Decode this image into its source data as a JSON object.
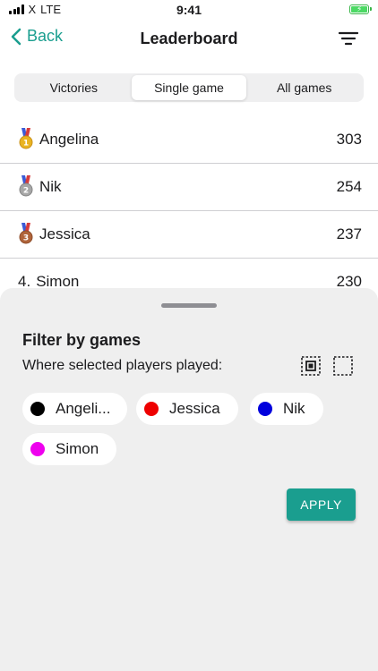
{
  "status_bar": {
    "carrier": "X",
    "network": "LTE",
    "time": "9:41"
  },
  "nav": {
    "back_label": "Back",
    "title": "Leaderboard"
  },
  "tabs": [
    {
      "label": "Victories",
      "active": false
    },
    {
      "label": "Single game",
      "active": true
    },
    {
      "label": "All games",
      "active": false
    }
  ],
  "leaderboard": [
    {
      "rank_prefix": "",
      "name": "Angelina",
      "score": "303",
      "medal": "gold"
    },
    {
      "rank_prefix": "",
      "name": "Nik",
      "score": "254",
      "medal": "silver"
    },
    {
      "rank_prefix": "",
      "name": "Jessica",
      "score": "237",
      "medal": "bronze"
    },
    {
      "rank_prefix": "4.",
      "name": "Simon",
      "score": "230",
      "medal": ""
    }
  ],
  "filter_sheet": {
    "title": "Filter by games",
    "subtitle": "Where selected players played:",
    "players": [
      {
        "name": "Angeli...",
        "color": "#000000"
      },
      {
        "name": "Jessica",
        "color": "#ee0000"
      },
      {
        "name": "Nik",
        "color": "#0000dd"
      },
      {
        "name": "Simon",
        "color": "#ee00ee"
      }
    ],
    "apply_label": "APPLY"
  },
  "colors": {
    "accent": "#1a9e8f",
    "medal_gold": "#e9b320",
    "medal_silver": "#a7a7a7",
    "medal_bronze": "#b0643a"
  }
}
